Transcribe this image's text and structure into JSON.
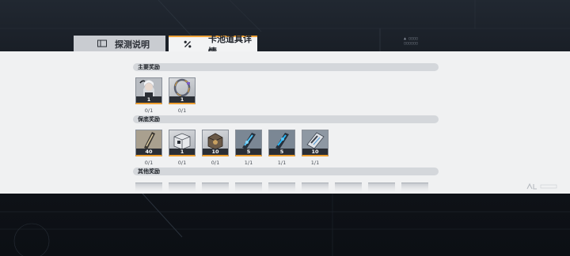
{
  "tabs": [
    {
      "label": "探测说明",
      "icon": "book-icon",
      "active": false
    },
    {
      "label": "卡池道具详情",
      "icon": "percent-icon",
      "active": true
    }
  ],
  "accent_color": "#f0a33a",
  "sections": {
    "main": {
      "title": "主要奖励",
      "items": [
        {
          "icon": "character-portrait-icon",
          "qty": "1",
          "progress": "0/1"
        },
        {
          "icon": "ring-icon",
          "qty": "1",
          "progress": "0/1"
        }
      ]
    },
    "guaranteed": {
      "title": "保底奖励",
      "items": [
        {
          "icon": "weapon-chip-icon",
          "qty": "40",
          "progress": "0/1"
        },
        {
          "icon": "crate-icon",
          "qty": "1",
          "progress": "0/1"
        },
        {
          "icon": "cube-box-icon",
          "qty": "10",
          "progress": "0/1"
        },
        {
          "icon": "blue-chip-icon",
          "qty": "5",
          "progress": "1/1"
        },
        {
          "icon": "blue-chip-icon",
          "qty": "5",
          "progress": "1/1"
        },
        {
          "icon": "data-card-icon",
          "qty": "10",
          "progress": "1/1"
        }
      ]
    },
    "other": {
      "title": "其他奖励"
    }
  }
}
